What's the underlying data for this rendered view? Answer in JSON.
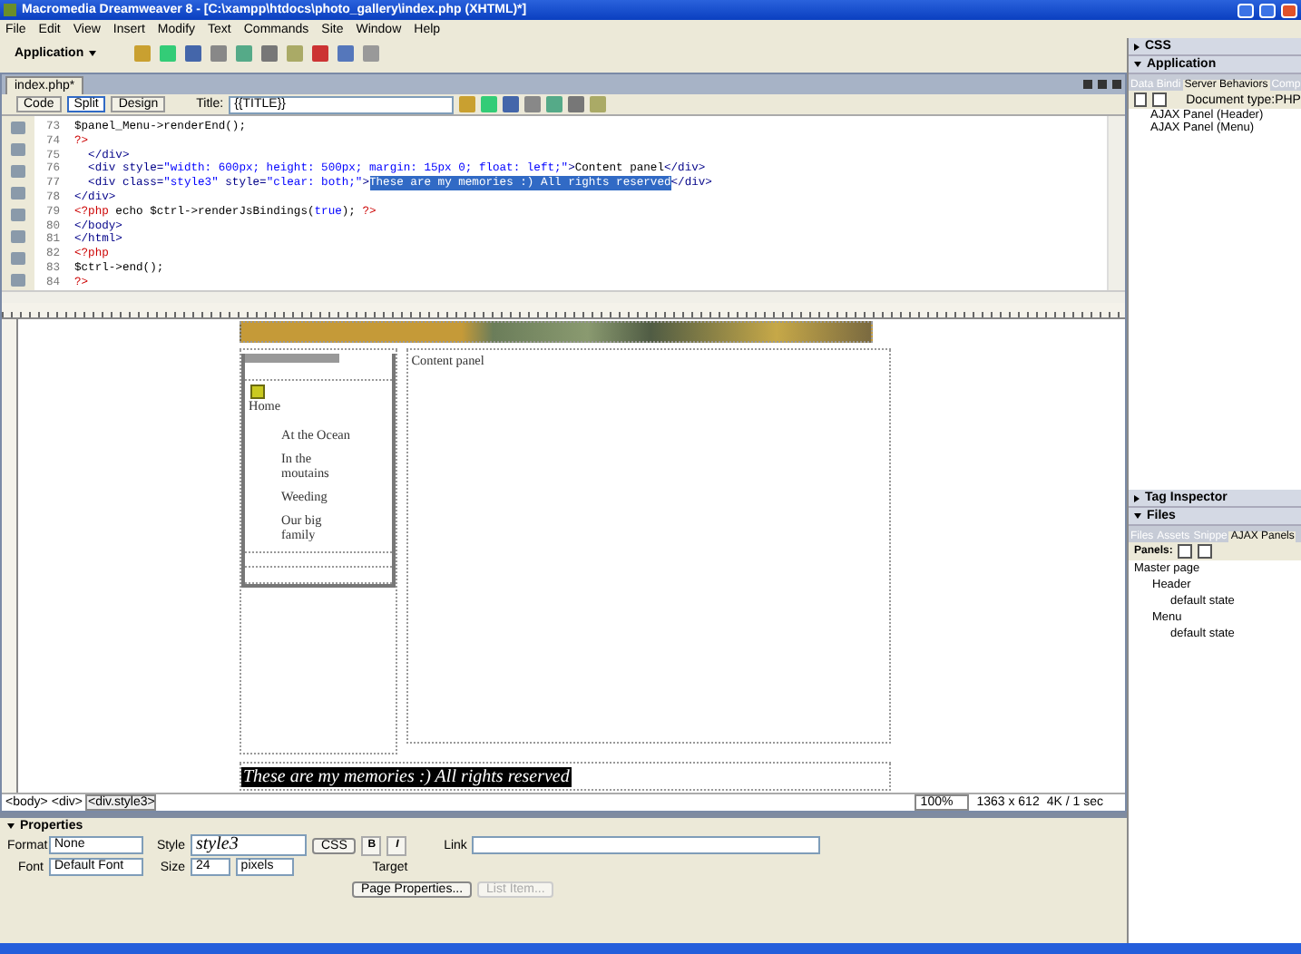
{
  "window": {
    "title": "Macromedia Dreamweaver 8 - [C:\\xampp\\htdocs\\photo_gallery\\index.php (XHTML)*]"
  },
  "menu": [
    "File",
    "Edit",
    "View",
    "Insert",
    "Modify",
    "Text",
    "Commands",
    "Site",
    "Window",
    "Help"
  ],
  "toolbar": {
    "category": "Application"
  },
  "document": {
    "tab": "index.php*",
    "views": [
      {
        "label": "Code",
        "selected": false
      },
      {
        "label": "Split",
        "selected": true
      },
      {
        "label": "Design",
        "selected": false
      }
    ],
    "title_label": "Title:",
    "title_value": "{{TITLE}}"
  },
  "code": {
    "lines": [
      {
        "number": "73",
        "segments": [
          {
            "kind": "text",
            "text": "$panel_Menu->renderEnd();"
          }
        ]
      },
      {
        "number": "74",
        "segments": [
          {
            "kind": "php",
            "text": "?>"
          }
        ]
      },
      {
        "number": "75",
        "segments": [
          {
            "kind": "tag",
            "text": "  </div>"
          }
        ]
      },
      {
        "number": "76",
        "segments": [
          {
            "kind": "tag",
            "text": "  <div style="
          },
          {
            "kind": "value",
            "text": "\"width: 600px; height: 500px; margin: 15px 0; float: left;\""
          },
          {
            "kind": "tag",
            "text": ">"
          },
          {
            "kind": "text",
            "text": "Content panel"
          },
          {
            "kind": "tag",
            "text": "</div>"
          }
        ]
      },
      {
        "number": "77",
        "segments": [
          {
            "kind": "tag",
            "text": "  <div class="
          },
          {
            "kind": "value",
            "text": "\"style3\""
          },
          {
            "kind": "tag",
            "text": " style="
          },
          {
            "kind": "value",
            "text": "\"clear: both;\""
          },
          {
            "kind": "tag",
            "text": ">"
          },
          {
            "kind": "selection",
            "text": "These are my memories :) All rights reserved"
          },
          {
            "kind": "tag",
            "text": "</div>"
          }
        ]
      },
      {
        "number": "78",
        "segments": [
          {
            "kind": "tag",
            "text": "</div>"
          }
        ]
      },
      {
        "number": "79",
        "segments": [
          {
            "kind": "php",
            "text": "<?php"
          },
          {
            "kind": "text",
            "text": " echo $ctrl->renderJsBindings("
          },
          {
            "kind": "value",
            "text": "true"
          },
          {
            "kind": "text",
            "text": "); "
          },
          {
            "kind": "php",
            "text": "?>"
          }
        ]
      },
      {
        "number": "80",
        "segments": [
          {
            "kind": "tag",
            "text": "</body>"
          }
        ]
      },
      {
        "number": "81",
        "segments": [
          {
            "kind": "tag",
            "text": "</html>"
          }
        ]
      },
      {
        "number": "82",
        "segments": [
          {
            "kind": "php",
            "text": "<?php"
          }
        ]
      },
      {
        "number": "83",
        "segments": [
          {
            "kind": "text",
            "text": "$ctrl->end();"
          }
        ]
      },
      {
        "number": "84",
        "segments": [
          {
            "kind": "php",
            "text": "?>"
          }
        ]
      }
    ]
  },
  "design": {
    "menu_items": [
      {
        "label": "Home",
        "kind": "top"
      },
      {
        "label": "At the Ocean",
        "kind": "sub"
      },
      {
        "label": "In the moutains",
        "kind": "sub"
      },
      {
        "label": "Weeding",
        "kind": "sub"
      },
      {
        "label": "Our big family",
        "kind": "sub"
      }
    ],
    "content_panel": "Content panel",
    "footer": "These are my memories :) All rights reserved"
  },
  "tag_selector": [
    {
      "label": "<body>",
      "selected": false
    },
    {
      "label": "<div>",
      "selected": false
    },
    {
      "label": "<div.style3>",
      "selected": true
    }
  ],
  "status": {
    "zoom": "100%",
    "size": "1363 x 612",
    "download": "4K / 1 sec"
  },
  "properties": {
    "title": "Properties",
    "format_label": "Format",
    "format": "None",
    "font_label": "Font",
    "font": "Default Font",
    "style_label": "Style",
    "style": "style3",
    "size_label": "Size",
    "size": "24",
    "unit": "pixels",
    "css_button": "CSS",
    "bold": "B",
    "italic": "I",
    "link_label": "Link",
    "target_label": "Target",
    "page_properties": "Page Properties...",
    "list_item": {
      "label": "List Item...",
      "disabled": true
    }
  },
  "panels": [
    {
      "title": "CSS",
      "expanded": false
    },
    {
      "title": "Application",
      "expanded": true,
      "tabs": [
        {
          "label": "Data Bindi",
          "selected": false
        },
        {
          "label": "Server Behaviors",
          "selected": true
        },
        {
          "label": "Comp",
          "selected": false
        }
      ],
      "doc_type": "Document type:PHP",
      "items": [
        "AJAX Panel (Header)",
        "AJAX Panel (Menu)"
      ]
    },
    {
      "title": "Tag Inspector",
      "expanded": false
    },
    {
      "title": "Files",
      "expanded": true,
      "tabs": [
        {
          "label": "Files",
          "selected": false
        },
        {
          "label": "Assets",
          "selected": false
        },
        {
          "label": "Snippe",
          "selected": false
        },
        {
          "label": "AJAX Panels",
          "selected": true
        }
      ],
      "panels_label": "Panels:",
      "tree": [
        {
          "label": "Master page",
          "children": [
            {
              "label": "Header",
              "children": [
                {
                  "label": "default state"
                }
              ]
            },
            {
              "label": "Menu",
              "children": [
                {
                  "label": "default state"
                }
              ]
            }
          ]
        }
      ]
    }
  ]
}
